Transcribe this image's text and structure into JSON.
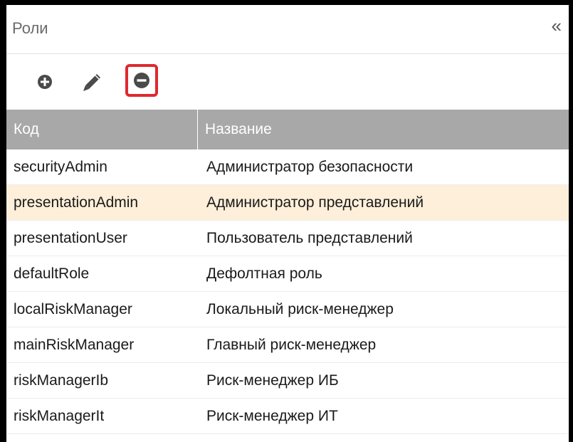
{
  "panel": {
    "title": "Роли",
    "collapse_symbol": "«"
  },
  "toolbar": {
    "add_icon": "plus-circle-icon",
    "edit_icon": "pencil-icon",
    "remove_icon": "minus-circle-icon",
    "remove_highlight_color": "#e0282f"
  },
  "table": {
    "columns": [
      "Код",
      "Название"
    ],
    "selected_row": 1,
    "rows": [
      {
        "code": "securityAdmin",
        "name": "Администратор безопасности"
      },
      {
        "code": "presentationAdmin",
        "name": "Администратор представлений"
      },
      {
        "code": "presentationUser",
        "name": "Пользователь представлений"
      },
      {
        "code": "defaultRole",
        "name": "Дефолтная роль"
      },
      {
        "code": "localRiskManager",
        "name": "Локальный риск-менеджер"
      },
      {
        "code": "mainRiskManager",
        "name": "Главный риск-менеджер"
      },
      {
        "code": "riskManagerIb",
        "name": "Риск-менеджер ИБ"
      },
      {
        "code": "riskManagerIt",
        "name": "Риск-менеджер ИТ"
      }
    ]
  },
  "colors": {
    "header_bg": "#a8a8a8",
    "selected_row_bg": "#fdefd9"
  }
}
